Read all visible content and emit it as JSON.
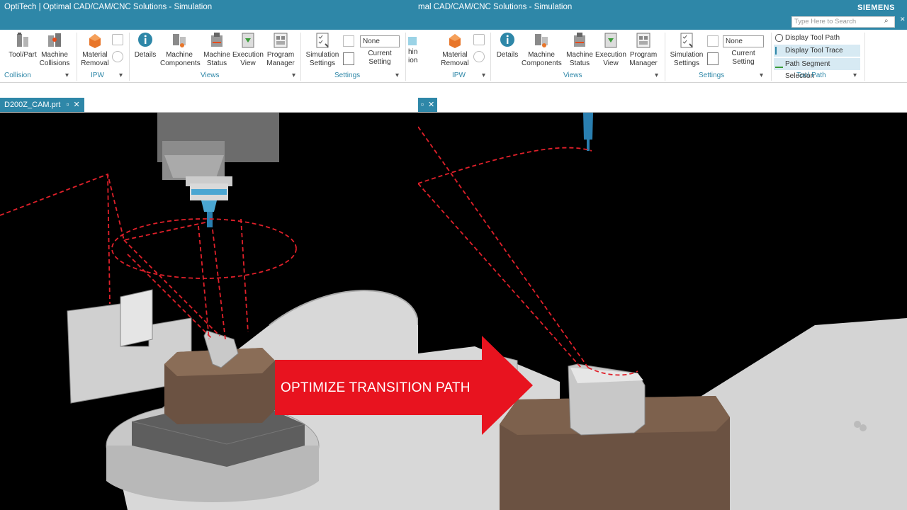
{
  "left_window": {
    "title": "OptiTech | Optimal CAD/CAM/CNC Solutions - Simulation",
    "buttons": [
      {
        "label1": "Tool/Part",
        "label2": ""
      },
      {
        "label1": "Machine",
        "label2": "Collisions"
      },
      {
        "label1": "Material",
        "label2": "Removal"
      },
      {
        "label1": "Details",
        "label2": ""
      },
      {
        "label1": "Machine",
        "label2": "Components"
      },
      {
        "label1": "Machine",
        "label2": "Status"
      },
      {
        "label1": "Execution",
        "label2": "View"
      },
      {
        "label1": "Program",
        "label2": "Manager"
      },
      {
        "label1": "Simulation",
        "label2": "Settings"
      },
      {
        "label1": "Current",
        "label2": "Setting"
      }
    ],
    "groups": {
      "collision": "Collision",
      "ipw": "IPW",
      "views": "Views",
      "settings": "Settings"
    },
    "setting_value": "None",
    "partial_button": {
      "label1": "hine",
      "label2": "ions"
    },
    "tab": "D200Z_CAM.prt"
  },
  "right_window": {
    "title": "mal CAD/CAM/CNC Solutions - Simulation",
    "brand": "SIEMENS",
    "search_placeholder": "Type Here to Search",
    "buttons": [
      {
        "label1": "Material",
        "label2": "Removal"
      },
      {
        "label1": "Details",
        "label2": ""
      },
      {
        "label1": "Machine",
        "label2": "Components"
      },
      {
        "label1": "Machine",
        "label2": "Status"
      },
      {
        "label1": "Execution",
        "label2": "View"
      },
      {
        "label1": "Program",
        "label2": "Manager"
      },
      {
        "label1": "Simulation",
        "label2": "Settings"
      },
      {
        "label1": "Current",
        "label2": "Setting"
      }
    ],
    "groups": {
      "ipw": "IPW",
      "views": "Views",
      "settings": "Settings",
      "toolpath": "Tool Path"
    },
    "setting_value": "None",
    "partial_button": {
      "label1": "hine",
      "label2": "ions"
    },
    "toolpath_items": [
      "Display Tool Path",
      "Display Tool Trace",
      "Path Segment Selection"
    ]
  },
  "banner_text": "OPTIMIZE TRANSITION PATH",
  "colors": {
    "titlebar": "#2e87a8",
    "banner": "#e8131f",
    "toolpath": "#e0202a",
    "workpiece": "#6b5242"
  }
}
